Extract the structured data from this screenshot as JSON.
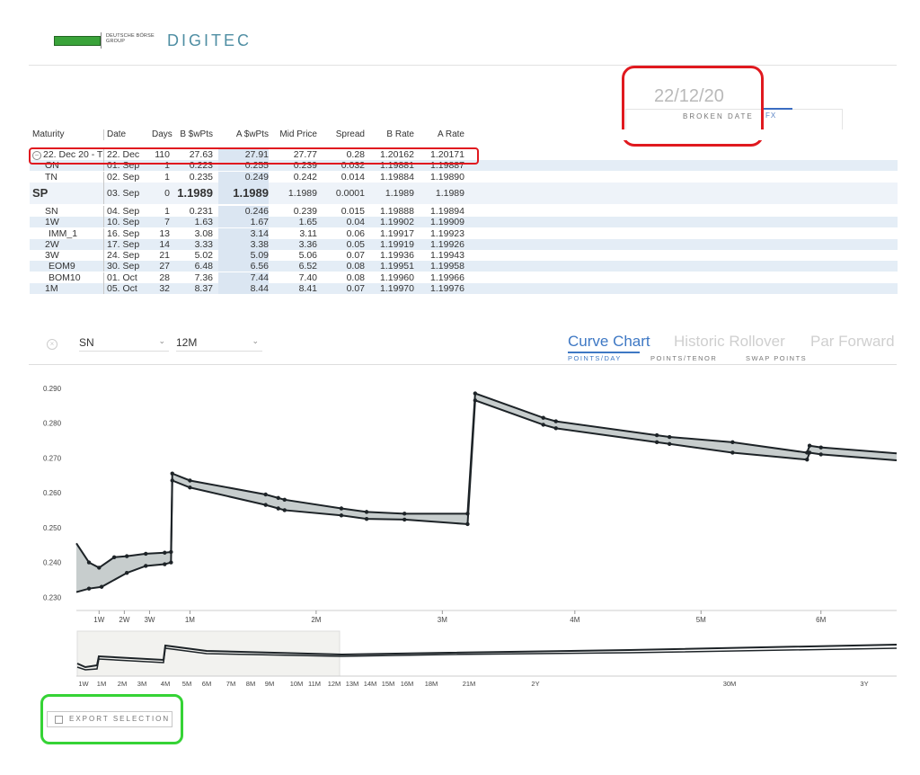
{
  "header": {
    "brand_group": "DEUTSCHE BÖRSE GROUP",
    "brand_name": "DIGITEC"
  },
  "broken_date": {
    "value": "22/12/20",
    "label": "BROKEN DATE",
    "tab": "FX"
  },
  "table": {
    "columns": [
      "Maturity",
      "Date",
      "Days",
      "B $wPts",
      "A $wPts",
      "Mid Price",
      "Spread",
      "B Rate",
      "A Rate"
    ],
    "rows": [
      {
        "maturity": "22. Dec 20 - T",
        "date": "22. Dec",
        "days": "110",
        "b_swpts": "27.63",
        "a_swpts": "27.91",
        "mid": "27.77",
        "spread": "0.28",
        "b_rate": "1.20162",
        "a_rate": "1.20171",
        "style": "plain",
        "has_icon": true
      },
      {
        "maturity": "ON",
        "date": "01. Sep",
        "days": "1",
        "b_swpts": "0.223",
        "a_swpts": "0.255",
        "mid": "0.239",
        "spread": "0.032",
        "b_rate": "1.19881",
        "a_rate": "1.19887",
        "style": "alt",
        "indent": "centered"
      },
      {
        "maturity": "TN",
        "date": "02. Sep",
        "days": "1",
        "b_swpts": "0.235",
        "a_swpts": "0.249",
        "mid": "0.242",
        "spread": "0.014",
        "b_rate": "1.19884",
        "a_rate": "1.19890",
        "style": "plain",
        "indent": "centered"
      },
      {
        "maturity": "SP",
        "date": "03. Sep",
        "days": "0",
        "b_swpts": "1.1989",
        "a_swpts": "1.1989",
        "mid": "1.1989",
        "spread": "0.0001",
        "b_rate": "1.1989",
        "a_rate": "1.1989",
        "style": "sp"
      },
      {
        "maturity": "SN",
        "date": "04. Sep",
        "days": "1",
        "b_swpts": "0.231",
        "a_swpts": "0.246",
        "mid": "0.239",
        "spread": "0.015",
        "b_rate": "1.19888",
        "a_rate": "1.19894",
        "style": "plain",
        "indent": "centered"
      },
      {
        "maturity": "1W",
        "date": "10. Sep",
        "days": "7",
        "b_swpts": "1.63",
        "a_swpts": "1.67",
        "mid": "1.65",
        "spread": "0.04",
        "b_rate": "1.19902",
        "a_rate": "1.19909",
        "style": "alt",
        "indent": "centered"
      },
      {
        "maturity": "IMM_1",
        "date": "16. Sep",
        "days": "13",
        "b_swpts": "3.08",
        "a_swpts": "3.14",
        "mid": "3.11",
        "spread": "0.06",
        "b_rate": "1.19917",
        "a_rate": "1.19923",
        "style": "plain",
        "indent": "indent"
      },
      {
        "maturity": "2W",
        "date": "17. Sep",
        "days": "14",
        "b_swpts": "3.33",
        "a_swpts": "3.38",
        "mid": "3.36",
        "spread": "0.05",
        "b_rate": "1.19919",
        "a_rate": "1.19926",
        "style": "alt",
        "indent": "centered"
      },
      {
        "maturity": "3W",
        "date": "24. Sep",
        "days": "21",
        "b_swpts": "5.02",
        "a_swpts": "5.09",
        "mid": "5.06",
        "spread": "0.07",
        "b_rate": "1.19936",
        "a_rate": "1.19943",
        "style": "plain",
        "indent": "centered"
      },
      {
        "maturity": "EOM9",
        "date": "30. Sep",
        "days": "27",
        "b_swpts": "6.48",
        "a_swpts": "6.56",
        "mid": "6.52",
        "spread": "0.08",
        "b_rate": "1.19951",
        "a_rate": "1.19958",
        "style": "alt",
        "indent": "indent"
      },
      {
        "maturity": "BOM10",
        "date": "01. Oct",
        "days": "28",
        "b_swpts": "7.36",
        "a_swpts": "7.44",
        "mid": "7.40",
        "spread": "0.08",
        "b_rate": "1.19960",
        "a_rate": "1.19966",
        "style": "plain",
        "indent": "indent"
      },
      {
        "maturity": "1M",
        "date": "05. Oct",
        "days": "32",
        "b_swpts": "8.37",
        "a_swpts": "8.44",
        "mid": "8.41",
        "spread": "0.07",
        "b_rate": "1.19970",
        "a_rate": "1.19976",
        "style": "alt",
        "indent": "centered"
      }
    ]
  },
  "controls": {
    "from_select": "SN",
    "to_select": "12M",
    "tabs": [
      "Curve Chart",
      "Historic Rollover",
      "Par Forward"
    ],
    "active_tab": "Curve Chart",
    "subtabs": [
      "POINTS/DAY",
      "POINTS/TENOR",
      "SWAP POINTS"
    ],
    "active_subtab": "POINTS/DAY"
  },
  "chart_data": {
    "type": "area",
    "yticks": [
      "0.290",
      "0.280",
      "0.270",
      "0.260",
      "0.250",
      "0.240",
      "0.230"
    ],
    "ylim": [
      0.227,
      0.292
    ],
    "xticks": [
      "1W",
      "2W",
      "3W",
      "1M",
      "2M",
      "3M",
      "4M",
      "5M",
      "6M",
      "7M"
    ],
    "series": [
      {
        "band": "upper",
        "points": [
          [
            0,
            0.2455
          ],
          [
            1,
            0.24
          ],
          [
            1.8,
            0.2385
          ],
          [
            3,
            0.2415
          ],
          [
            4,
            0.2418
          ],
          [
            5.5,
            0.2425
          ],
          [
            7,
            0.2428
          ],
          [
            7.5,
            0.243
          ],
          [
            7.6,
            0.2655
          ],
          [
            9,
            0.2635
          ],
          [
            15,
            0.2595
          ],
          [
            16,
            0.2585
          ],
          [
            16.5,
            0.258
          ],
          [
            21,
            0.2555
          ],
          [
            23,
            0.2545
          ],
          [
            26,
            0.254
          ],
          [
            31,
            0.254
          ],
          [
            31.6,
            0.2885
          ],
          [
            37,
            0.2815
          ],
          [
            38,
            0.2805
          ],
          [
            46,
            0.2765
          ],
          [
            47,
            0.276
          ],
          [
            52,
            0.2745
          ],
          [
            57.9,
            0.2715
          ],
          [
            58.1,
            0.2735
          ],
          [
            59,
            0.273
          ],
          [
            65,
            0.2713
          ]
        ]
      },
      {
        "band": "lower",
        "points": [
          [
            0,
            0.2315
          ],
          [
            1,
            0.2325
          ],
          [
            2,
            0.233
          ],
          [
            4,
            0.237
          ],
          [
            5.5,
            0.239
          ],
          [
            7,
            0.2395
          ],
          [
            7.5,
            0.24
          ],
          [
            7.6,
            0.2635
          ],
          [
            9,
            0.2615
          ],
          [
            15,
            0.2565
          ],
          [
            16,
            0.2555
          ],
          [
            16.5,
            0.255
          ],
          [
            21,
            0.2535
          ],
          [
            23,
            0.2525
          ],
          [
            26,
            0.2523
          ],
          [
            31,
            0.251
          ],
          [
            31.6,
            0.2865
          ],
          [
            37,
            0.2795
          ],
          [
            38,
            0.2785
          ],
          [
            46,
            0.2745
          ],
          [
            47,
            0.274
          ],
          [
            52,
            0.2715
          ],
          [
            57.9,
            0.2695
          ],
          [
            58.1,
            0.2715
          ],
          [
            59,
            0.271
          ],
          [
            65,
            0.2693
          ]
        ]
      }
    ],
    "navigator_ticks": [
      "1W",
      "1M",
      "2M",
      "3M",
      "4M",
      "5M",
      "6M",
      "7M",
      "8M",
      "9M",
      "10M",
      "11M",
      "12M",
      "13M",
      "14M",
      "15M",
      "16M",
      "18M",
      "21M",
      "2Y",
      "30M",
      "3Y"
    ]
  },
  "export": {
    "label": "EXPORT SELECTION"
  },
  "colors": {
    "accent": "#3e78c4",
    "highlight_red": "#e0191f",
    "highlight_green": "#35d335",
    "band_fill": "#c7cdcd"
  }
}
